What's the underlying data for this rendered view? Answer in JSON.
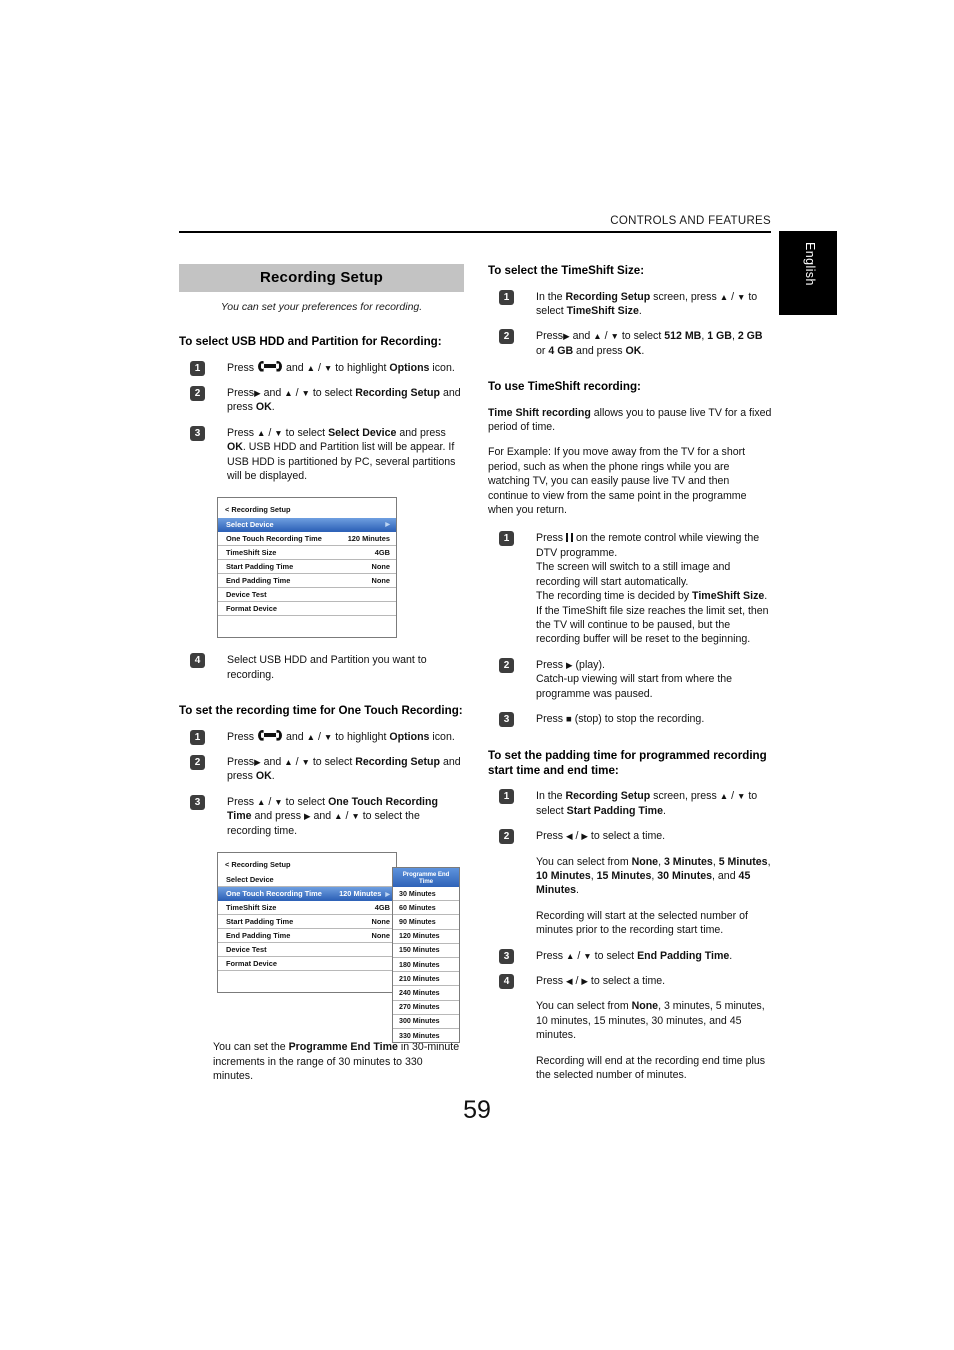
{
  "header": {
    "running_title": "CONTROLS AND FEATURES",
    "language_tab": "English"
  },
  "banner": {
    "title": "Recording Setup",
    "subtitle": "You can set your preferences for recording."
  },
  "page_number": "59",
  "left_column": {
    "section1": {
      "heading": "To select USB HDD and Partition for Recording:",
      "steps": [
        {
          "num": "1",
          "pre": "Press ",
          "icon": "wrench-icon",
          "post_a": " and ",
          "post_b": " / ",
          "post_c": " to highlight ",
          "bold": "Options",
          "tail": " icon."
        },
        {
          "num": "2",
          "line1_a": "Press",
          "line1_b": " and ",
          "line1_c": " / ",
          "line1_d": " to select ",
          "line1_bold": "Recording Setup",
          "line2_a": "and press ",
          "line2_bold": "OK",
          "line2_tail": "."
        },
        {
          "num": "3",
          "text": "Press ▲ / ▼ to select Select Device and press OK. USB HDD and Partition list will be appear. If USB HDD is partitioned by PC, several partitions will be displayed."
        },
        {
          "num": "4",
          "text": "Select USB HDD and Partition you want to recording."
        }
      ]
    },
    "menu1": {
      "title": "< Recording Setup",
      "rows": [
        {
          "label": "Select Device",
          "value": "",
          "selected": true,
          "arrow": "▶"
        },
        {
          "label": "One Touch Recording Time",
          "value": "120 Minutes",
          "selected": false
        },
        {
          "label": "TimeShift Size",
          "value": "4GB",
          "selected": false
        },
        {
          "label": "Start Padding Time",
          "value": "None",
          "selected": false
        },
        {
          "label": "End Padding Time",
          "value": "None",
          "selected": false
        },
        {
          "label": "Device Test",
          "value": "",
          "selected": false
        },
        {
          "label": "Format Device",
          "value": "",
          "selected": false
        }
      ]
    },
    "section2": {
      "heading": "To set the recording time for One Touch Recording:",
      "steps": [
        {
          "num": "1",
          "text": "Press ⚒ and ▲ / ▼ to highlight Options icon."
        },
        {
          "num": "2",
          "text": "Press ▶ and ▲ / ▼ to select Recording Setup and press OK."
        },
        {
          "num": "3",
          "text": "Press ▲ / ▼ to select One Touch Recording Time and press ▶ and ▲ / ▼ to select the recording time."
        }
      ]
    },
    "menu2": {
      "title": "< Recording Setup",
      "rows": [
        {
          "label": "Select Device",
          "value": "",
          "selected": false
        },
        {
          "label": "One Touch Recording Time",
          "value": "120 Minutes",
          "selected": true,
          "arrow": "▶"
        },
        {
          "label": "TimeShift Size",
          "value": "4GB",
          "selected": false
        },
        {
          "label": "Start Padding Time",
          "value": "None",
          "selected": false
        },
        {
          "label": "End Padding Time",
          "value": "None",
          "selected": false
        },
        {
          "label": "Device Test",
          "value": "",
          "selected": false
        },
        {
          "label": "Format Device",
          "value": "",
          "selected": false
        }
      ],
      "dropdown": {
        "header": "Programme End Time",
        "items": [
          "30 Minutes",
          "60 Minutes",
          "90 Minutes",
          "120 Minutes",
          "150 Minutes",
          "180 Minutes",
          "210 Minutes",
          "240 Minutes",
          "270 Minutes",
          "300 Minutes",
          "330 Minutes"
        ]
      }
    },
    "closing_note": "You can set the Programme End Time in 30-minute increments in the range of 30 minutes to 330 minutes."
  },
  "right_column": {
    "section1": {
      "heading": "To select the TimeShift Size:",
      "steps": [
        {
          "num": "1",
          "text": "In the Recording Setup screen, press ▲ / ▼ to select TimeShift Size."
        },
        {
          "num": "2",
          "text": "Press ▶ and ▲ / ▼ to select 512 MB, 1 GB, 2 GB or 4 GB and press OK."
        }
      ]
    },
    "section2": {
      "heading": "To use TimeShift recording:",
      "intro_bold": "Time Shift recording",
      "intro_rest": " allows you to pause live TV for a fixed period of time.",
      "example": "For Example: If you move away from the TV for a short period, such as when the phone rings while you are watching TV, you can easily pause live TV and then continue to view from the same point in the programme when you return.",
      "steps": [
        {
          "num": "1",
          "text": "Press ⏸ on the remote control while viewing the DTV programme. The screen will switch to a still image and recording will start automatically. The recording time is decided by TimeShift Size. If the TimeShift file size reaches the limit set, then the TV will continue to be paused, but the recording buffer will be reset to the beginning."
        },
        {
          "num": "2",
          "text": "Press ▶ (play). Catch-up viewing will start from where the programme was paused."
        },
        {
          "num": "3",
          "text": "Press ■ (stop) to stop the recording."
        }
      ]
    },
    "section3": {
      "heading": "To set the padding time for programmed recording start time and end time:",
      "steps": [
        {
          "num": "1",
          "text": "In the Recording Setup screen, press ▲ / ▼ to select Start Padding Time."
        },
        {
          "num": "2",
          "text": "Press ◀ / ▶ to select a time."
        },
        {
          "num": "3",
          "text": "Press ▲ / ▼ to select End Padding Time."
        },
        {
          "num": "4",
          "text": "Press ◀ / ▶ to select a time."
        }
      ],
      "note_start_options": "You can select from None, 3 Minutes, 5 Minutes, 10 Minutes, 15 Minutes, 30 Minutes, and 45 Minutes.",
      "note_start_effect": "Recording will start at the selected number of minutes prior to the recording start time.",
      "note_end_options": "You can select from None, 3 minutes, 5 minutes, 10 minutes, 15 minutes, 30 minutes, and 45 minutes.",
      "note_end_effect": "Recording will end at the recording end time plus the selected number of minutes."
    }
  },
  "labels": {
    "step1": "1",
    "step2": "2",
    "step3": "3",
    "step4": "4",
    "press": "Press",
    "and": "and",
    "slash": "/",
    "ok": "OK"
  }
}
